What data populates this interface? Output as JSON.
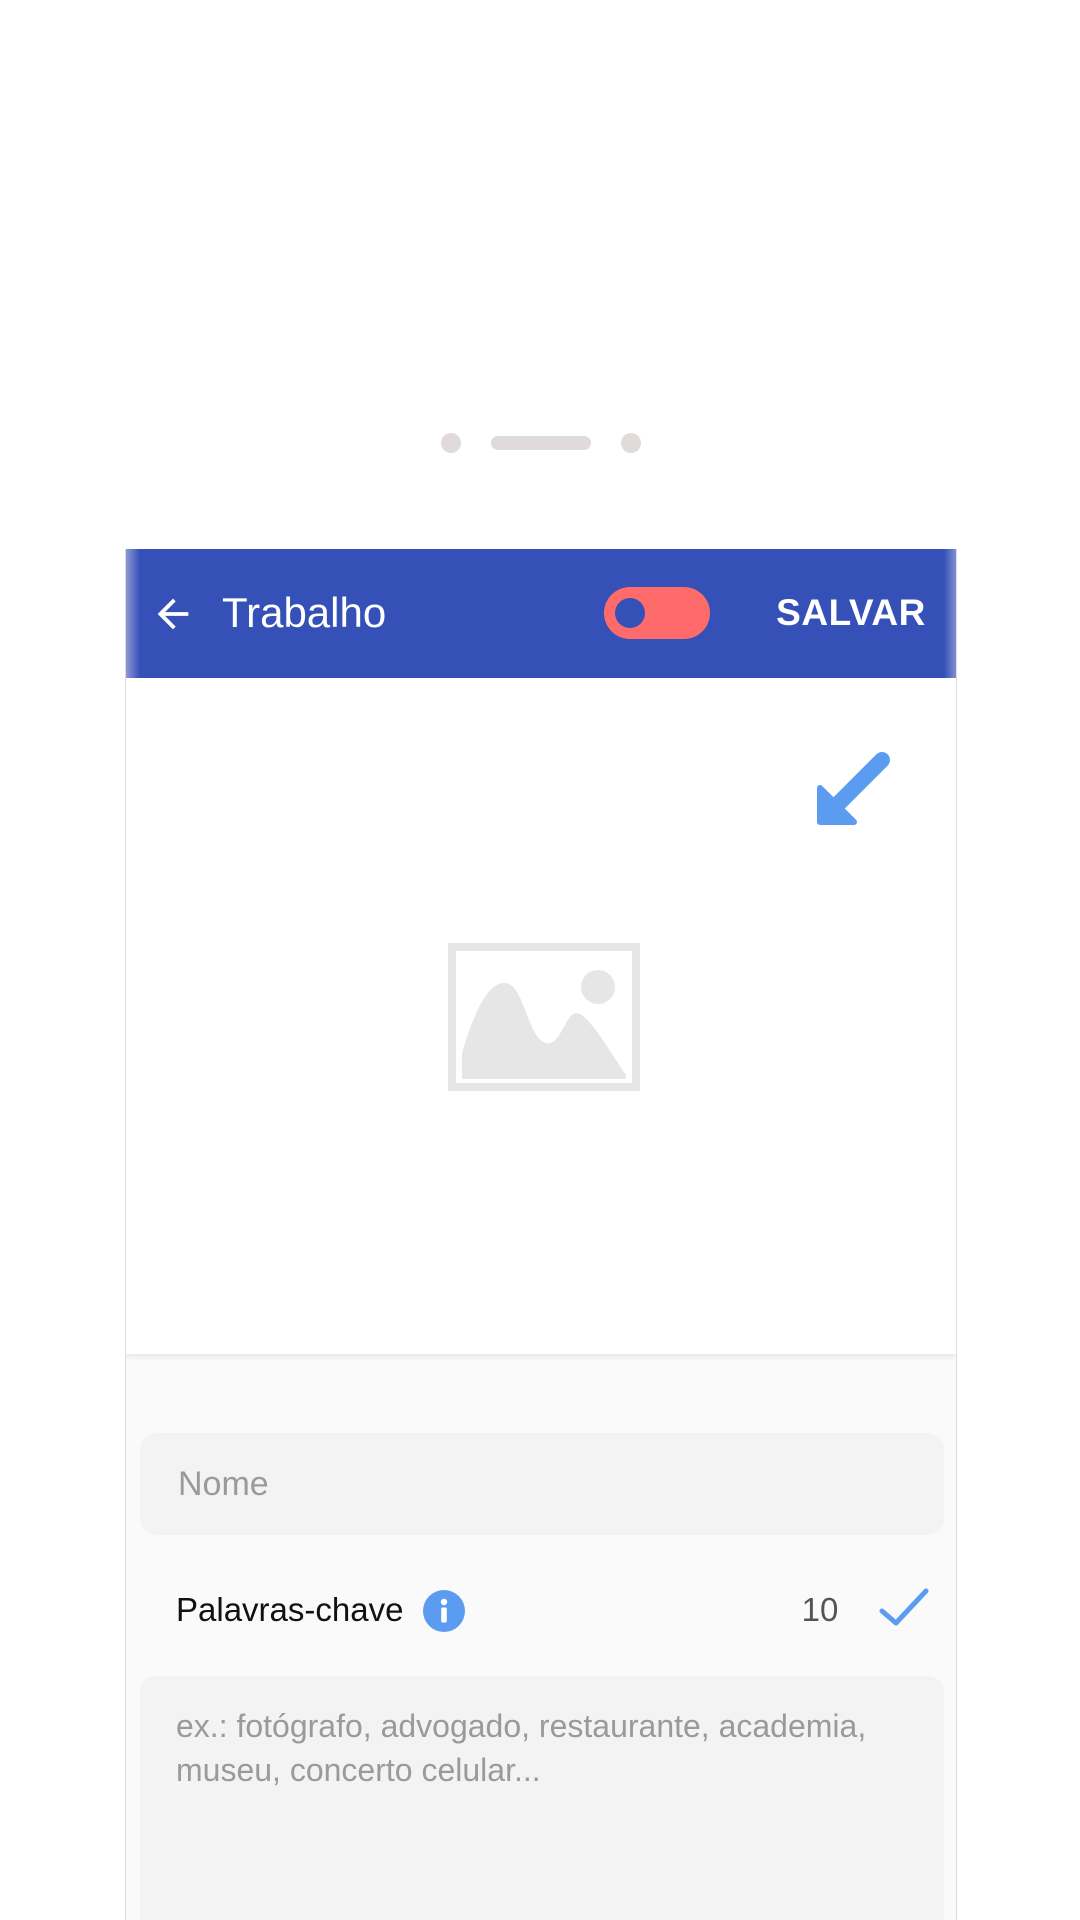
{
  "appbar": {
    "title": "Trabalho",
    "save_label": "SALVAR",
    "toggle_on": false,
    "accent_color": "#3551b8",
    "toggle_color": "#ff6b6b"
  },
  "image_area": {
    "corner_icon": "arrow-down-left-icon",
    "placeholder_icon": "image-placeholder-icon"
  },
  "form": {
    "name_placeholder": "Nome",
    "keywords_label": "Palavras-chave",
    "keywords_count": "10",
    "keywords_placeholder": "ex.: fotógrafo, advogado, restaurante, academia, museu, concerto celular..."
  }
}
